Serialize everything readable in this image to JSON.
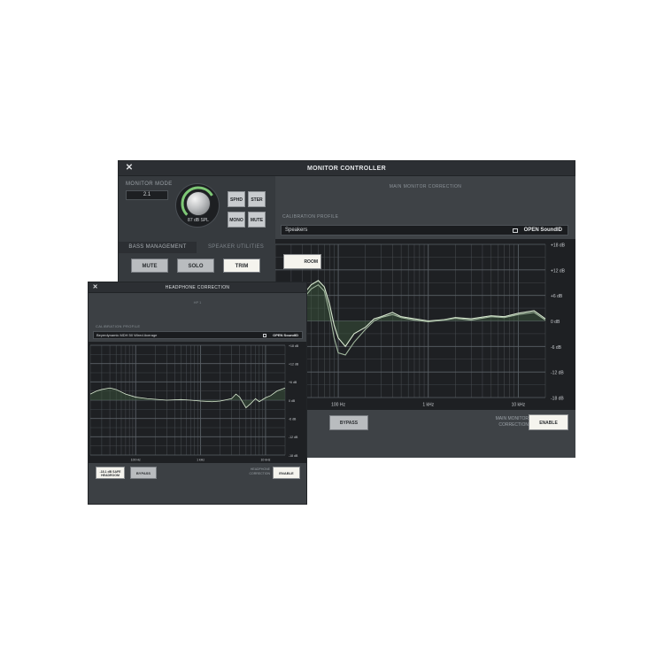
{
  "main_window": {
    "title": "MONITOR CONTROLLER",
    "close_glyph": "✕",
    "monitor_mode": {
      "label": "MONITOR MODE",
      "value": "2.1"
    },
    "volume": {
      "readout": "87 dB SPL",
      "level": 0.72
    },
    "mode_buttons": {
      "sphd": "SPHD",
      "ster": "STER",
      "mono": "MONO",
      "mute": "MUTE"
    },
    "tabs": {
      "bass": "BASS MANAGEMENT",
      "speaker": "SPEAKER UTILITIES"
    },
    "utility_buttons": {
      "mute": "MUTE",
      "solo": "SOLO",
      "trim": "TRIM"
    },
    "correction_title": "MAIN MONITOR CORRECTION",
    "calibration": {
      "label": "CALIBRATION PROFILE",
      "value": "Speakers",
      "brand": "OPEN SoundID"
    },
    "graph": {
      "y_labels": [
        "+18 dB",
        "+12 dB",
        "+6 dB",
        "0 dB",
        "-6 dB",
        "-12 dB",
        "-18 dB"
      ],
      "x_labels": [
        "100 Hz",
        "1 kHz",
        "10 kHz"
      ]
    },
    "headroom_label": "-18.1 dB SAFE HEADROOM",
    "headroom_visible": "ROOM",
    "bypass_label": "BYPASS",
    "correction_label_1": "MAIN MONITOR",
    "correction_label_2": "CORRECTION",
    "enable_label": "ENABLE"
  },
  "hp_window": {
    "title": "HEADPHONE CORRECTION",
    "close_glyph": "✕",
    "preset": "HP 1",
    "calibration": {
      "label": "CALIBRATION PROFILE",
      "value": "Beyerdynamic MDH 50 Wired Average",
      "brand": "OPEN SoundID"
    },
    "graph": {
      "y_labels": [
        "+18 dB",
        "+12 dB",
        "+6 dB",
        "0 dB",
        "-6 dB",
        "-12 dB",
        "-18 dB"
      ],
      "x_labels": [
        "100 Hz",
        "1 kHz",
        "10 kHz"
      ]
    },
    "headroom_line1": "-18.1 dB SAFE",
    "headroom_line2": "HEADROOM",
    "bypass_label": "BYPASS",
    "correction_label_1": "HEADPHONE",
    "correction_label_2": "CORRECTION",
    "enable_label": "ENABLE"
  },
  "colors": {
    "curve": "#d8e8d0",
    "curve_dim": "#9fb59c",
    "fill": "#3e5a3e",
    "grid": "#4a4f54",
    "accent": "#7ec876"
  },
  "chart_data": [
    {
      "type": "line",
      "title": "MAIN MONITOR CORRECTION",
      "xlabel": "",
      "ylabel": "",
      "x_scale": "log",
      "xlim": [
        20,
        20000
      ],
      "ylim": [
        -18,
        18
      ],
      "x_ticks": [
        "100 Hz",
        "1 kHz",
        "10 kHz"
      ],
      "y_ticks": [
        "+18 dB",
        "+12 dB",
        "+6 dB",
        "0 dB",
        "-6 dB",
        "-12 dB",
        "-18 dB"
      ],
      "grid": true,
      "series": [
        {
          "x": [
            20,
            25,
            30,
            40,
            50,
            60,
            70,
            80,
            90,
            100,
            120,
            150,
            200,
            250,
            300,
            400,
            500,
            700,
            1000,
            1500,
            2000,
            3000,
            5000,
            7000,
            10000,
            15000,
            20000
          ],
          "values": [
            -1,
            1,
            3,
            6,
            8.5,
            9.5,
            8,
            4,
            -1,
            -4,
            -6,
            -3,
            -1.5,
            0.5,
            1,
            2,
            1,
            0.5,
            0,
            0.3,
            0.8,
            0.5,
            1.2,
            1,
            1.8,
            2.4,
            0.5
          ]
        },
        {
          "x": [
            20,
            25,
            30,
            40,
            50,
            60,
            70,
            80,
            90,
            100,
            120,
            150,
            200,
            250,
            300,
            400,
            500,
            700,
            1000,
            1500,
            2000,
            3000,
            5000,
            7000,
            10000,
            15000,
            20000
          ],
          "values": [
            -2,
            0,
            2,
            5,
            7.5,
            8.5,
            7,
            2,
            -4,
            -7.5,
            -8,
            -5,
            -2,
            0,
            0.8,
            1.5,
            0.8,
            0.2,
            -0.2,
            0.2,
            0.6,
            0.2,
            1,
            0.8,
            1.5,
            2,
            0.2
          ]
        }
      ]
    },
    {
      "type": "line",
      "title": "HEADPHONE CORRECTION",
      "xlabel": "",
      "ylabel": "",
      "x_scale": "log",
      "xlim": [
        20,
        20000
      ],
      "ylim": [
        -18,
        18
      ],
      "x_ticks": [
        "100 Hz",
        "1 kHz",
        "10 kHz"
      ],
      "y_ticks": [
        "+18 dB",
        "+12 dB",
        "+6 dB",
        "0 dB",
        "-6 dB",
        "-12 dB",
        "-18 dB"
      ],
      "grid": true,
      "series": [
        {
          "x": [
            20,
            25,
            30,
            40,
            50,
            70,
            100,
            150,
            200,
            300,
            500,
            700,
            1000,
            1500,
            2000,
            3000,
            3500,
            4000,
            5000,
            6000,
            7000,
            8000,
            10000,
            12000,
            15000,
            20000
          ],
          "values": [
            2,
            3,
            3.5,
            4,
            3.5,
            2,
            1,
            0.5,
            0.3,
            0,
            0.2,
            0,
            -0.3,
            -0.5,
            -0.3,
            0.5,
            2,
            1,
            -2.5,
            -1,
            0.5,
            -0.5,
            0.8,
            1.5,
            3,
            4
          ]
        }
      ]
    }
  ]
}
